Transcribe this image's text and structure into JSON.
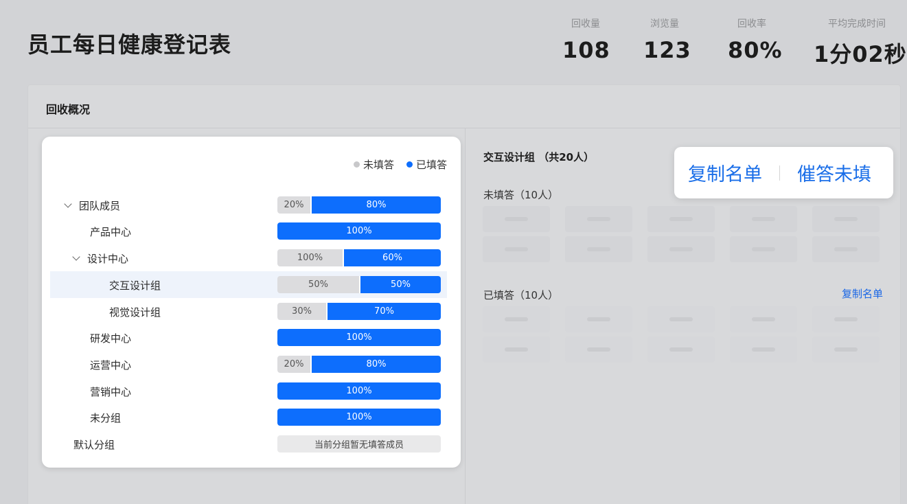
{
  "page": {
    "title": "员工每日健康登记表"
  },
  "stats": [
    {
      "label": "回收量",
      "value": "108"
    },
    {
      "label": "浏览量",
      "value": "123"
    },
    {
      "label": "回收率",
      "value": "80%"
    },
    {
      "label": "平均完成时间",
      "value": "1分02秒"
    }
  ],
  "panel": {
    "title": "回收概况"
  },
  "legend": {
    "unfilled": "未填答",
    "filled": "已填答",
    "unfilled_color": "#c8c8ca",
    "filled_color": "#0d6efd"
  },
  "tree": [
    {
      "label": "团队成员",
      "expanded": true,
      "unfilled_pct": "20%",
      "filled_pct": "80%",
      "filled_fraction": 0.8
    },
    {
      "label": "产品中心",
      "unfilled_pct": "",
      "filled_pct": "100%",
      "filled_fraction": 1.0
    },
    {
      "label": "设计中心",
      "expanded": true,
      "unfilled_pct": "100%",
      "filled_pct": "60%",
      "filled_fraction": 0.6
    },
    {
      "label": "交互设计组",
      "unfilled_pct": "50%",
      "filled_pct": "50%",
      "filled_fraction": 0.5,
      "selected": true
    },
    {
      "label": "视觉设计组",
      "unfilled_pct": "30%",
      "filled_pct": "70%",
      "filled_fraction": 0.7
    },
    {
      "label": "研发中心",
      "unfilled_pct": "",
      "filled_pct": "100%",
      "filled_fraction": 1.0
    },
    {
      "label": "运营中心",
      "unfilled_pct": "20%",
      "filled_pct": "80%",
      "filled_fraction": 0.8
    },
    {
      "label": "营销中心",
      "unfilled_pct": "",
      "filled_pct": "100%",
      "filled_fraction": 1.0
    },
    {
      "label": "未分组",
      "unfilled_pct": "",
      "filled_pct": "100%",
      "filled_fraction": 1.0
    },
    {
      "label": "默认分组",
      "empty_text": "当前分组暂无填答成员"
    }
  ],
  "detail": {
    "group_title": "交互设计组 （共20人）",
    "unfilled_label": "未填答（10人）",
    "filled_label": "已填答（10人）",
    "copy_list": "复制名单"
  },
  "popover": {
    "copy_list": "复制名单",
    "remind": "催答未填"
  }
}
